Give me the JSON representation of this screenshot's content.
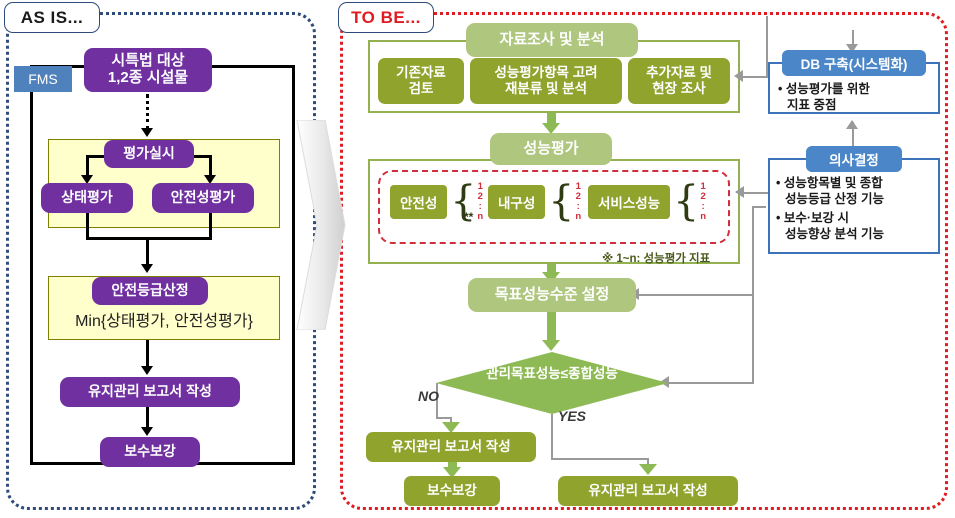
{
  "panels": {
    "asis": {
      "tag": "AS IS...",
      "fms_label": "FMS",
      "nodes": {
        "target": "시특법 대상\n1,2종 시설물",
        "target_line1": "시특법 대상",
        "target_line2": "1,2종 시설물",
        "evaluation": "평가실시",
        "state_eval": "상태평가",
        "safety_eval": "안전성평가",
        "grade_calc": "안전등급산정",
        "min_formula": "Min{상태평가, 안전성평가}",
        "report": "유지관리 보고서 작성",
        "repair": "보수보강"
      }
    },
    "tobe": {
      "tag": "TO BE...",
      "nodes": {
        "survey": "자료조사 및 분석",
        "existing_data": "기존자료\n검토",
        "existing_data_l1": "기존자료",
        "existing_data_l2": "검토",
        "reclassify_l1": "성능평가항목 고려",
        "reclassify_l2": "재분류 및 분석",
        "field_survey_l1": "추가자료 및",
        "field_survey_l2": "현장 조사",
        "performance_eval": "성능평가",
        "target_level": "목표성능수준 설정",
        "decision_diamond": "관리목표성능≤종합성능",
        "branch_no": "NO",
        "branch_yes": "YES",
        "report_no": "유지관리 보고서 작성",
        "repair": "보수보강",
        "report_yes": "유지관리 보고서 작성",
        "asterisks": "**",
        "note": "※ 1~n: 성능평가 지표"
      },
      "performance_items": [
        {
          "label": "안전성",
          "indices": [
            "1",
            "2",
            ":",
            "n"
          ]
        },
        {
          "label": "내구성",
          "indices": [
            "1",
            "2",
            ":",
            "n"
          ]
        },
        {
          "label": "서비스성능",
          "indices": [
            "1",
            "2",
            ":",
            "n"
          ]
        }
      ],
      "side_boxes": {
        "db": {
          "title": "DB 구축(시스템화)",
          "bullets": [
            {
              "line1": "성능평가를 위한",
              "line2": "지표 중점"
            }
          ]
        },
        "decision": {
          "title": "의사결정",
          "bullets": [
            {
              "line1": "성능항목별 및 종합",
              "line2": "성능등급 산정 기능"
            },
            {
              "line1": "보수·보강 시",
              "line2": "성능향상 분석 기능"
            }
          ]
        }
      }
    }
  },
  "colors": {
    "purple": "#7030A0",
    "light_yellow": "#FFFFCC",
    "fms_blue": "#4F81BD",
    "green_dark": "#8FA32D",
    "green_light": "#AEC67E",
    "green_diamond": "#8DBA54",
    "frame_green": "#93B150",
    "red_dash": "#D12D3A",
    "blue_border": "#3C72B9",
    "blue_tag": "#4A86C8",
    "asis_border": "#2E4B7A",
    "tobe_border": "#E01B22"
  }
}
